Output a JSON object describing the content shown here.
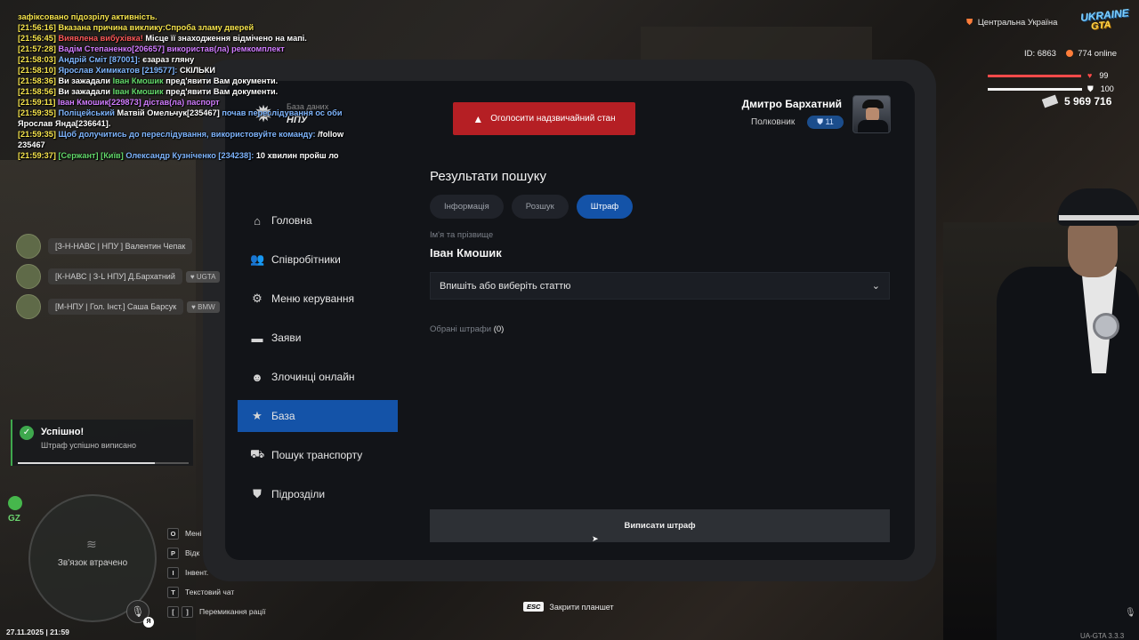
{
  "chat": [
    [
      {
        "t": " зафіксовано підозрілу активність.",
        "c": "c-y"
      }
    ],
    [
      {
        "t": "[21:56:16] Вказана причина виклику:Спроба зламу дверей",
        "c": "c-y"
      }
    ],
    [
      {
        "t": "[21:56:45] ",
        "c": "c-y"
      },
      {
        "t": "Виявлена вибухівка! ",
        "c": "c-r"
      },
      {
        "t": "Місце її знаходження відмічено на мапі.",
        "c": "c-w"
      }
    ],
    [
      {
        "t": "[21:57:28] ",
        "c": "c-y"
      },
      {
        "t": "Вадім Степаненко[206657] використав(ла) ремкомплект",
        "c": "c-p"
      }
    ],
    [
      {
        "t": "[21:58:03] ",
        "c": "c-y"
      },
      {
        "t": "Андрій Сміт [87001]: ",
        "c": "c-b"
      },
      {
        "t": "єзараз гляну",
        "c": "c-w"
      }
    ],
    [
      {
        "t": "[21:58:10] ",
        "c": "c-y"
      },
      {
        "t": "Ярослав Химикатов [219577]: ",
        "c": "c-b"
      },
      {
        "t": "СКІЛЬКИ",
        "c": "c-w"
      }
    ],
    [
      {
        "t": "[21:58:36] ",
        "c": "c-y"
      },
      {
        "t": "Ви зажадали ",
        "c": "c-w"
      },
      {
        "t": "Іван Кмошик ",
        "c": "c-g"
      },
      {
        "t": "пред'явити Вам документи.",
        "c": "c-w"
      }
    ],
    [
      {
        "t": "[21:58:56] ",
        "c": "c-y"
      },
      {
        "t": "Ви зажадали ",
        "c": "c-w"
      },
      {
        "t": "Іван Кмошик ",
        "c": "c-g"
      },
      {
        "t": "пред'явити Вам документи.",
        "c": "c-w"
      }
    ],
    [
      {
        "t": "[21:59:11] ",
        "c": "c-y"
      },
      {
        "t": "Іван Кмошик[229873] дістав(ла) паспорт",
        "c": "c-p"
      }
    ],
    [
      {
        "t": "[21:59:35] ",
        "c": "c-y"
      },
      {
        "t": "Поліцейський ",
        "c": "c-b"
      },
      {
        "t": "Матвій Омельчук[235467] ",
        "c": "c-w"
      },
      {
        "t": "почав переслідування ос оби ",
        "c": "c-b"
      },
      {
        "t": "Ярослав Янда[236641].",
        "c": "c-w"
      }
    ],
    [
      {
        "t": "[21:59:35] ",
        "c": "c-y"
      },
      {
        "t": "Щоб долучитись до переслідування, використовуйте команду: ",
        "c": "c-b"
      },
      {
        "t": "/follow 235467",
        "c": "c-w"
      }
    ],
    [
      {
        "t": "[21:59:37] ",
        "c": "c-y"
      },
      {
        "t": "[Сержант] [Київ] ",
        "c": "c-g"
      },
      {
        "t": " Олександр Кузніченко [234238]: ",
        "c": "c-b"
      },
      {
        "t": "10 хвилин пройш ло",
        "c": "c-w"
      }
    ]
  ],
  "players": [
    {
      "name": "[З-Н-НАВС | НПУ ] Валентин Чепак",
      "tag": ""
    },
    {
      "name": "[К-НАВС | З-L НПУ] Д.Бархатний",
      "tag": "UGTA"
    },
    {
      "name": "[М-НПУ | Гол. Інст.] Саша Барсук",
      "tag": "BMW"
    }
  ],
  "notification": {
    "title": "Успішно!",
    "text": "Штраф успішно виписано",
    "progress": 0.8
  },
  "gz_label": "GZ",
  "minimap": {
    "status": "Зв'язок втрачено"
  },
  "mic_key": "Я",
  "hints": [
    {
      "keys": [
        "O"
      ],
      "label": "Мені"
    },
    {
      "keys": [
        "P"
      ],
      "label": "Відк"
    },
    {
      "keys": [
        "I"
      ],
      "label": "Інвент."
    },
    {
      "keys": [
        "T"
      ],
      "label": "Текстовий чат"
    },
    {
      "keys": [
        "[",
        "]"
      ],
      "label": "Перемикання рації"
    }
  ],
  "datetime": "27.11.2025 | 21:59",
  "version": "UA-GTA 3.3.3",
  "hud": {
    "region": "Центральна Україна",
    "logo_top": "UKRAINE",
    "logo_bottom": "GTA",
    "id_label": "ID: 6863",
    "online": "774 online",
    "health": "99",
    "health_level": 99,
    "armor": "100",
    "armor_level": 100,
    "money": "5 969 716"
  },
  "tablet": {
    "brand_sub": "База даних",
    "brand_main": "НПУ",
    "alert_button": "Оголосити надзвичайний стан",
    "user_name": "Дмитро Бархатний",
    "user_rank": "Полковник",
    "rank_badge": "11",
    "nav": [
      {
        "icon": "home-icon",
        "glyph": "⌂",
        "label": "Головна",
        "active": false
      },
      {
        "icon": "staff-icon",
        "glyph": "👥",
        "label": "Співробітники",
        "active": false
      },
      {
        "icon": "gear-icon",
        "glyph": "⚙",
        "label": "Меню керування",
        "active": false
      },
      {
        "icon": "folder-icon",
        "glyph": "▬",
        "label": "Заяви",
        "active": false
      },
      {
        "icon": "mask-icon",
        "glyph": "☻",
        "label": "Злочинці онлайн",
        "active": false
      },
      {
        "icon": "star-icon",
        "glyph": "★",
        "label": "База",
        "active": true
      },
      {
        "icon": "car-icon",
        "glyph": "⛟",
        "label": "Пошук транспорту",
        "active": false
      },
      {
        "icon": "shield-icon",
        "glyph": "⛊",
        "label": "Підрозділи",
        "active": false
      }
    ],
    "results_title": "Результати пошуку",
    "tabs": [
      {
        "label": "Інформація",
        "active": false
      },
      {
        "label": "Розшук",
        "active": false
      },
      {
        "label": "Штраф",
        "active": true
      }
    ],
    "fio_label": "Ім'я та прізвище",
    "fio_value": "Іван Кмошик",
    "select_placeholder": "Впишіть або виберіть статтю",
    "chosen_label": "Обрані штрафи",
    "chosen_count": "(0)",
    "submit_label": "Виписати штраф",
    "esc_key": "ESC",
    "esc_label": "Закрити планшет"
  }
}
